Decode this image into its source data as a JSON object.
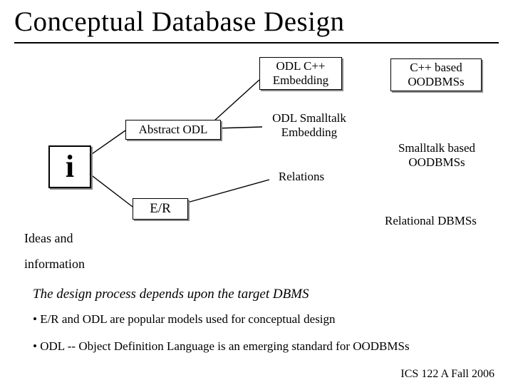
{
  "title": "Conceptual Database Design",
  "info_icon_glyph": "i",
  "nodes": {
    "abstract_odl": "Abstract ODL",
    "er": "E/R",
    "odl_cpp": "ODL C++\nEmbedding",
    "odl_smalltalk": "ODL Smalltalk\nEmbedding",
    "relations": "Relations",
    "cpp_dbms": "C++ based\nOODBMSs",
    "smalltalk_dbms": "Smalltalk based\nOODBMSs",
    "relational_dbms": "Relational DBMSs"
  },
  "labels": {
    "ideas": "Ideas and",
    "information": "information"
  },
  "notes": {
    "line1": "The  design process depends upon the target DBMS",
    "line2": "• E/R and ODL are popular models used for conceptual design",
    "line3": "• ODL -- Object Definition Language is an emerging standard for OODBMSs"
  },
  "footer": "ICS 122 A Fall 2006"
}
